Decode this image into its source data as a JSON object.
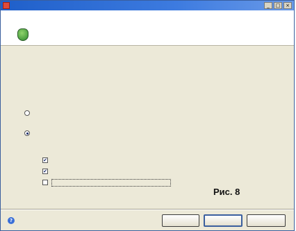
{
  "window": {
    "title": "",
    "controls": {
      "minimize": "_",
      "maximize": "□",
      "close": "×"
    }
  },
  "header": {
    "title": ""
  },
  "body": {
    "description": "",
    "prompt": "",
    "modes": [
      {
        "text": "",
        "selected": false
      },
      {
        "text": "",
        "selected": true
      }
    ],
    "options": [
      {
        "text": "",
        "checked": true
      },
      {
        "text": "",
        "checked": true
      },
      {
        "text": "",
        "checked": false
      }
    ]
  },
  "caption": "Рис. 8",
  "footer": {
    "help_label": "",
    "back_label": "",
    "next_label": "",
    "cancel_label": ""
  },
  "colors": {
    "titlebar": "#1f5fc9",
    "dialog_bg": "#ece9d8",
    "link": "#1a3fb0",
    "shield": "#2f8a2f"
  },
  "icons": [
    "app-icon",
    "shield-icon",
    "help-icon"
  ]
}
